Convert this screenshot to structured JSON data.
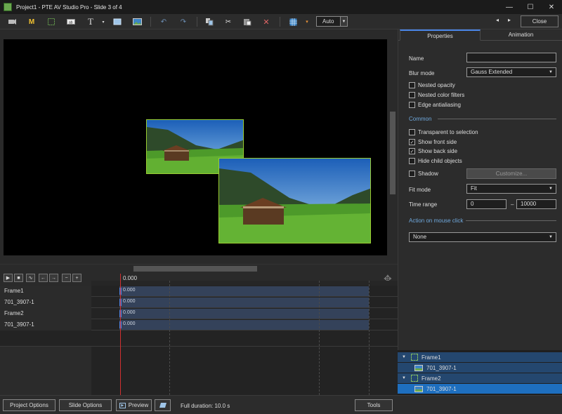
{
  "window": {
    "title": "Project1 - PTE AV Studio Pro - Slide 3 of 4",
    "minimize": "—",
    "maximize": "☐",
    "close": "✕"
  },
  "toolbar": {
    "mode_label": "Auto",
    "close_label": "Close",
    "prev_arrow": "◂",
    "next_arrow": "▸",
    "icons": [
      "camera-icon",
      "mask-icon",
      "frame-icon",
      "text-box-icon",
      "text-icon",
      "rectangle-icon",
      "image-icon",
      "undo-icon",
      "redo-icon",
      "copy-icon",
      "cut-icon",
      "paste-icon",
      "delete-icon",
      "grid-icon",
      "grid-color-icon"
    ]
  },
  "timeline": {
    "time_label": "0.000",
    "tracks": [
      {
        "name": "Frame1",
        "value": "0.000"
      },
      {
        "name": "701_3907-1",
        "value": "0.000"
      },
      {
        "name": "Frame2",
        "value": "0.000"
      },
      {
        "name": "701_3907-1",
        "value": "0.000"
      }
    ]
  },
  "properties": {
    "tabs": [
      "Properties",
      "Animation"
    ],
    "name_label": "Name",
    "name_value": "",
    "blur_mode_label": "Blur mode",
    "blur_mode_value": "Gauss Extended",
    "checks_top": [
      {
        "label": "Nested opacity",
        "checked": false
      },
      {
        "label": "Nested color filters",
        "checked": false
      },
      {
        "label": "Edge antialiasing",
        "checked": false
      }
    ],
    "common_section": "Common",
    "checks_common": [
      {
        "label": "Transparent to selection",
        "checked": false
      },
      {
        "label": "Show front side",
        "checked": true
      },
      {
        "label": "Show back side",
        "checked": true
      },
      {
        "label": "Hide child objects",
        "checked": false
      }
    ],
    "shadow_label": "Shadow",
    "customize_label": "Customize...",
    "fit_mode_label": "Fit mode",
    "fit_mode_value": "Fit",
    "time_range_label": "Time range",
    "time_range_from": "0",
    "time_range_dash": "–",
    "time_range_to": "10000",
    "action_section": "Action on mouse click",
    "action_value": "None"
  },
  "object_tree": [
    {
      "label": "Frame1",
      "type": "frame"
    },
    {
      "label": "701_3907-1",
      "type": "image"
    },
    {
      "label": "Frame2",
      "type": "frame"
    },
    {
      "label": "701_3907-1",
      "type": "image"
    }
  ],
  "bottombar": {
    "project_options": "Project Options",
    "slide_options": "Slide Options",
    "preview": "Preview",
    "full_duration": "Full duration: 10.0 s",
    "tools": "Tools"
  },
  "colors": {
    "accent": "#4a86e8",
    "frame_border": "#9acd32",
    "playhead": "#d03030",
    "section_title": "#6fa8dc"
  }
}
